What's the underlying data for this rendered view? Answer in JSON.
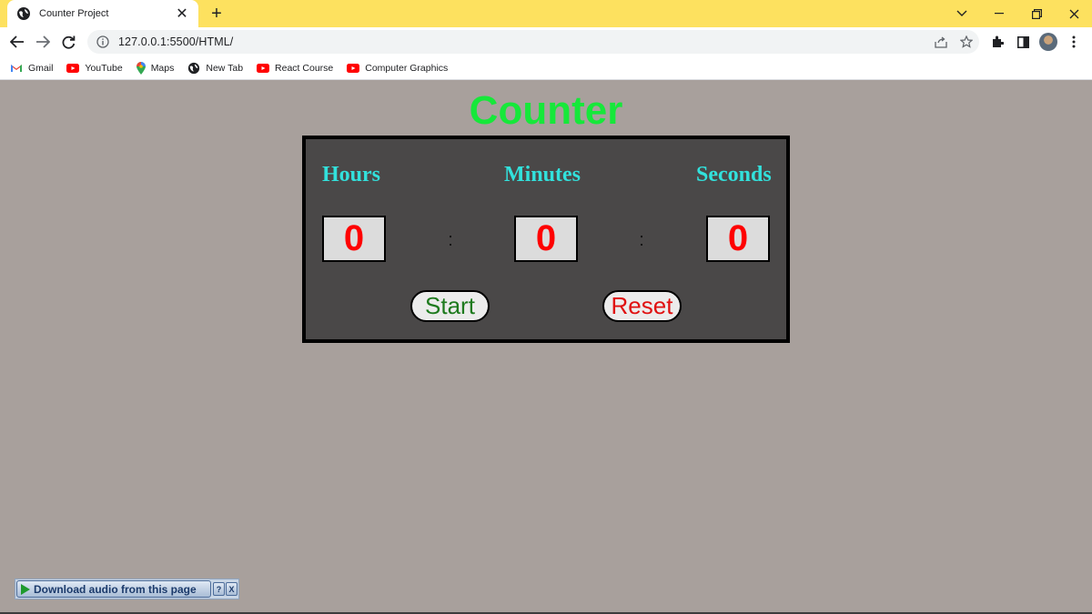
{
  "browser": {
    "tab_title": "Counter Project",
    "new_tab_symbol": "+",
    "close_symbol": "✕",
    "url": "127.0.0.1:5500/HTML/",
    "bookmarks": [
      {
        "label": "Gmail",
        "icon": "gmail-icon"
      },
      {
        "label": "YouTube",
        "icon": "youtube-icon"
      },
      {
        "label": "Maps",
        "icon": "maps-icon"
      },
      {
        "label": "New Tab",
        "icon": "globe-icon"
      },
      {
        "label": "React Course",
        "icon": "youtube-icon"
      },
      {
        "label": "Computer Graphics",
        "icon": "youtube-icon"
      }
    ],
    "colors": {
      "tabstrip": "#fde15f",
      "toolbar": "#ffffff"
    }
  },
  "page": {
    "title": "Counter",
    "labels": {
      "hours": "Hours",
      "minutes": "Minutes",
      "seconds": "Seconds"
    },
    "values": {
      "hours": "0",
      "minutes": "0",
      "seconds": "0"
    },
    "separator": ":",
    "buttons": {
      "start": "Start",
      "reset": "Reset"
    },
    "colors": {
      "background": "#a8a09c",
      "title": "#16e83a",
      "panel": "#4a4848",
      "labels": "#32e1dc",
      "digits": "#ff0000",
      "start_text": "#1e7a1e",
      "reset_text": "#e01010"
    }
  },
  "widget": {
    "download_label": "Download audio from this page",
    "help_symbol": "?",
    "close_symbol": "X"
  }
}
